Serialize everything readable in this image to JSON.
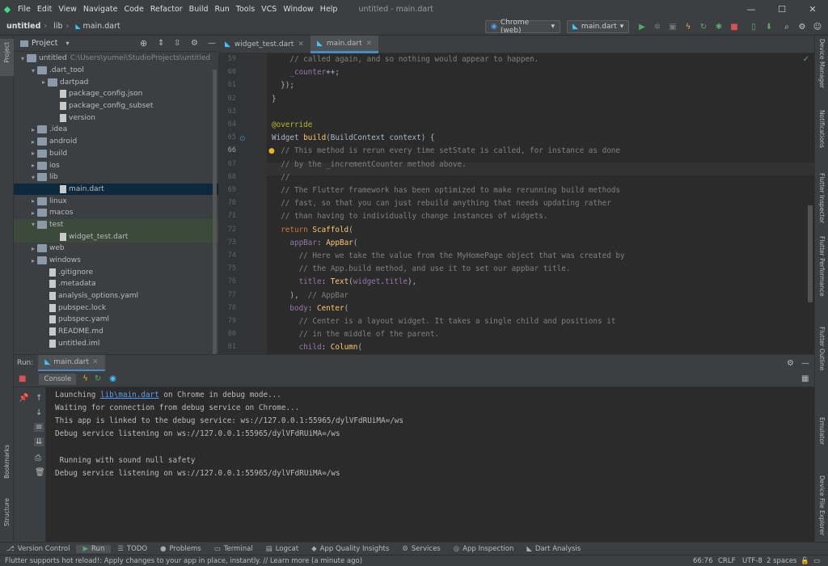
{
  "menu": {
    "items": [
      "File",
      "Edit",
      "View",
      "Navigate",
      "Code",
      "Refactor",
      "Build",
      "Run",
      "Tools",
      "VCS",
      "Window",
      "Help"
    ],
    "title": "untitled - main.dart"
  },
  "breadcrumb": {
    "project": "untitled",
    "folder": "lib",
    "file": "main.dart"
  },
  "toolbar": {
    "device": "Chrome (web)",
    "config": "main.dart"
  },
  "project": {
    "header": "Project",
    "tree": [
      {
        "label": "untitled",
        "path": "C:\\Users\\yumei\\StudioProjects\\untitled",
        "indent": 0,
        "arrow": "▾",
        "type": "folder"
      },
      {
        "label": ".dart_tool",
        "indent": 1,
        "arrow": "▾",
        "type": "folder"
      },
      {
        "label": "dartpad",
        "indent": 2,
        "arrow": "▸",
        "type": "folder"
      },
      {
        "label": "package_config.json",
        "indent": 3,
        "arrow": "",
        "type": "file"
      },
      {
        "label": "package_config_subset",
        "indent": 3,
        "arrow": "",
        "type": "file"
      },
      {
        "label": "version",
        "indent": 3,
        "arrow": "",
        "type": "file"
      },
      {
        "label": ".idea",
        "indent": 1,
        "arrow": "▸",
        "type": "folder"
      },
      {
        "label": "android",
        "indent": 1,
        "arrow": "▸",
        "type": "folder"
      },
      {
        "label": "build",
        "indent": 1,
        "arrow": "▸",
        "type": "folder"
      },
      {
        "label": "ios",
        "indent": 1,
        "arrow": "▸",
        "type": "folder"
      },
      {
        "label": "lib",
        "indent": 1,
        "arrow": "▾",
        "type": "folder"
      },
      {
        "label": "main.dart",
        "indent": 3,
        "arrow": "",
        "type": "file",
        "state": "sel"
      },
      {
        "label": "linux",
        "indent": 1,
        "arrow": "▸",
        "type": "folder"
      },
      {
        "label": "macos",
        "indent": 1,
        "arrow": "▸",
        "type": "folder"
      },
      {
        "label": "test",
        "indent": 1,
        "arrow": "▾",
        "type": "folder",
        "state": "hl"
      },
      {
        "label": "widget_test.dart",
        "indent": 3,
        "arrow": "",
        "type": "file",
        "state": "hl"
      },
      {
        "label": "web",
        "indent": 1,
        "arrow": "▸",
        "type": "folder"
      },
      {
        "label": "windows",
        "indent": 1,
        "arrow": "▸",
        "type": "folder"
      },
      {
        "label": ".gitignore",
        "indent": 2,
        "arrow": "",
        "type": "file"
      },
      {
        "label": ".metadata",
        "indent": 2,
        "arrow": "",
        "type": "file"
      },
      {
        "label": "analysis_options.yaml",
        "indent": 2,
        "arrow": "",
        "type": "file"
      },
      {
        "label": "pubspec.lock",
        "indent": 2,
        "arrow": "",
        "type": "file"
      },
      {
        "label": "pubspec.yaml",
        "indent": 2,
        "arrow": "",
        "type": "file"
      },
      {
        "label": "README.md",
        "indent": 2,
        "arrow": "",
        "type": "file"
      },
      {
        "label": "untitled.iml",
        "indent": 2,
        "arrow": "",
        "type": "file"
      }
    ]
  },
  "tabs": [
    {
      "label": "widget_test.dart"
    },
    {
      "label": "main.dart"
    }
  ],
  "editor": {
    "lines": [
      {
        "n": "59",
        "segs": [
          [
            "cm",
            "    // called again, and so nothing would appear to happen."
          ]
        ]
      },
      {
        "n": "60",
        "segs": [
          [
            "pu",
            "    _counter"
          ],
          [
            "",
            "++;"
          ]
        ]
      },
      {
        "n": "61",
        "segs": [
          [
            "",
            "  });"
          ]
        ]
      },
      {
        "n": "62",
        "segs": [
          [
            "",
            "}"
          ]
        ]
      },
      {
        "n": "63",
        "segs": [
          [
            "",
            ""
          ]
        ]
      },
      {
        "n": "64",
        "segs": [
          [
            "an",
            "@override"
          ]
        ]
      },
      {
        "n": "65",
        "segs": [
          [
            "",
            "Widget "
          ],
          [
            "fn",
            "build"
          ],
          [
            "",
            "(BuildContext context) {"
          ]
        ]
      },
      {
        "n": "66",
        "segs": [
          [
            "cm",
            "  // This method is rerun every time setState is called, for instance as done"
          ]
        ]
      },
      {
        "n": "67",
        "segs": [
          [
            "cm",
            "  // by the _incrementCounter method above."
          ]
        ]
      },
      {
        "n": "68",
        "segs": [
          [
            "cm",
            "  //"
          ]
        ]
      },
      {
        "n": "69",
        "segs": [
          [
            "cm",
            "  // The Flutter framework has been optimized to make rerunning build methods"
          ]
        ]
      },
      {
        "n": "70",
        "segs": [
          [
            "cm",
            "  // fast, so that you can just rebuild anything that needs updating rather"
          ]
        ]
      },
      {
        "n": "71",
        "segs": [
          [
            "cm",
            "  // than having to individually change instances of widgets."
          ]
        ]
      },
      {
        "n": "72",
        "segs": [
          [
            "kw",
            "  return "
          ],
          [
            "fn",
            "Scaffold"
          ],
          [
            "",
            "("
          ]
        ]
      },
      {
        "n": "73",
        "segs": [
          [
            "pu",
            "    appBar"
          ],
          [
            "",
            ": "
          ],
          [
            "fn",
            "AppBar"
          ],
          [
            "",
            "("
          ]
        ]
      },
      {
        "n": "74",
        "segs": [
          [
            "cm",
            "      // Here we take the value from the MyHomePage object that was created by"
          ]
        ]
      },
      {
        "n": "75",
        "segs": [
          [
            "cm",
            "      // the App.build method, and use it to set our appbar title."
          ]
        ]
      },
      {
        "n": "76",
        "segs": [
          [
            "pu",
            "      title"
          ],
          [
            "",
            ": "
          ],
          [
            "fn",
            "Text"
          ],
          [
            "",
            "("
          ],
          [
            "pu",
            "widget"
          ],
          [
            "",
            "."
          ],
          [
            "pu",
            "title"
          ],
          [
            "",
            "),"
          ]
        ]
      },
      {
        "n": "77",
        "segs": [
          [
            "",
            "    ),  "
          ],
          [
            "cm",
            "// AppBar"
          ]
        ]
      },
      {
        "n": "78",
        "segs": [
          [
            "pu",
            "    body"
          ],
          [
            "",
            ": "
          ],
          [
            "fn",
            "Center"
          ],
          [
            "",
            "("
          ]
        ]
      },
      {
        "n": "79",
        "segs": [
          [
            "cm",
            "      // Center is a layout widget. It takes a single child and positions it"
          ]
        ]
      },
      {
        "n": "80",
        "segs": [
          [
            "cm",
            "      // in the middle of the parent."
          ]
        ]
      },
      {
        "n": "81",
        "segs": [
          [
            "pu",
            "      child"
          ],
          [
            "",
            ": "
          ],
          [
            "fn",
            "Column"
          ],
          [
            "",
            "("
          ]
        ]
      }
    ]
  },
  "run": {
    "label": "Run:",
    "config": "main.dart",
    "console_tab": "Console",
    "output_intro": "Launching ",
    "output_link": "lib\\main.dart",
    "output_rest": " on Chrome in debug mode...",
    "lines": [
      "Waiting for connection from debug service on Chrome...",
      "This app is linked to the debug service: ws://127.0.0.1:55965/dylVFdRUiMA=/ws",
      "Debug service listening on ws://127.0.0.1:55965/dylVFdRUiMA=/ws",
      "",
      " Running with sound null safety",
      "Debug service listening on ws://127.0.0.1:55965/dylVFdRUiMA=/ws"
    ]
  },
  "bottom_tools": [
    "Version Control",
    "Run",
    "TODO",
    "Problems",
    "Terminal",
    "Logcat",
    "App Quality Insights",
    "Services",
    "App Inspection",
    "Dart Analysis"
  ],
  "left_tools": {
    "project": "Project",
    "bookmarks": "Bookmarks",
    "structure": "Structure"
  },
  "right_tools": [
    "Device Manager",
    "Notifications",
    "Flutter Inspector",
    "Flutter Performance",
    "Flutter Outline",
    "Emulator",
    "Device File Explorer"
  ],
  "status": {
    "message": "Flutter supports hot reload!: Apply changes to your app in place, instantly. // Learn more (a minute ago)",
    "position": "66:76",
    "line_sep": "CRLF",
    "encoding": "UTF-8",
    "indent": "2 spaces"
  }
}
